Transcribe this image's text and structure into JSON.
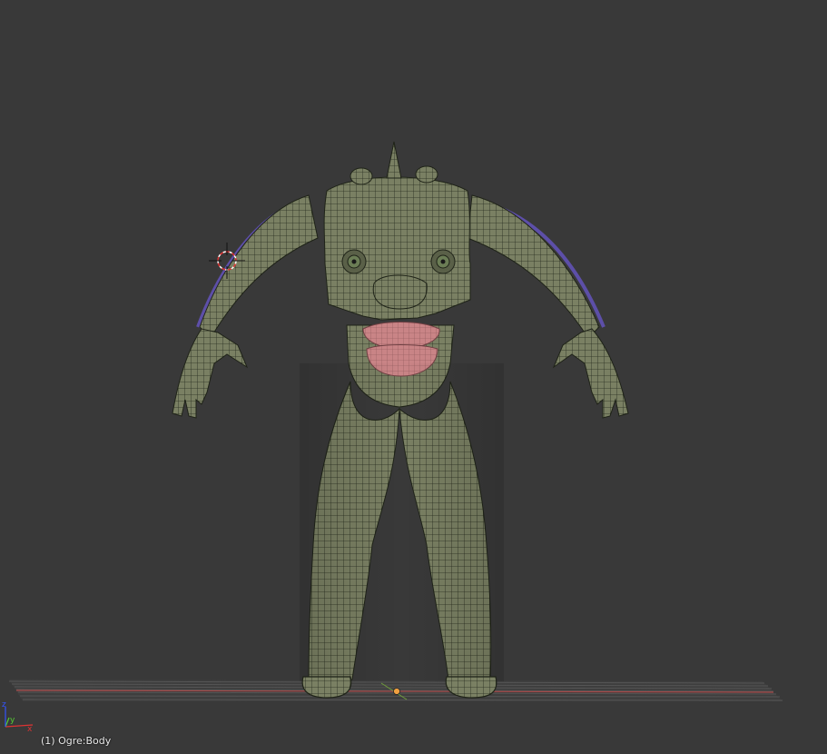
{
  "viewport": {
    "object_label": "(1) Ogre:Body",
    "background_color": "#393939",
    "mesh_color": "#7a8063",
    "wire_color": "#262b1e",
    "lip_color": "#c98486",
    "selection_outline_color": "#5d4fa8",
    "grid_color": "#555555",
    "x_axis_color": "#a64848",
    "y_axis_color": "#6f9b3b"
  },
  "axis_gizmo": {
    "labels": [
      "x",
      "y",
      "z"
    ],
    "colors": [
      "#dd3333",
      "#55cc33",
      "#3355ff"
    ]
  },
  "icons": [
    "3d-cursor-icon",
    "object-origin-icon",
    "axis-gizmo-icon"
  ]
}
